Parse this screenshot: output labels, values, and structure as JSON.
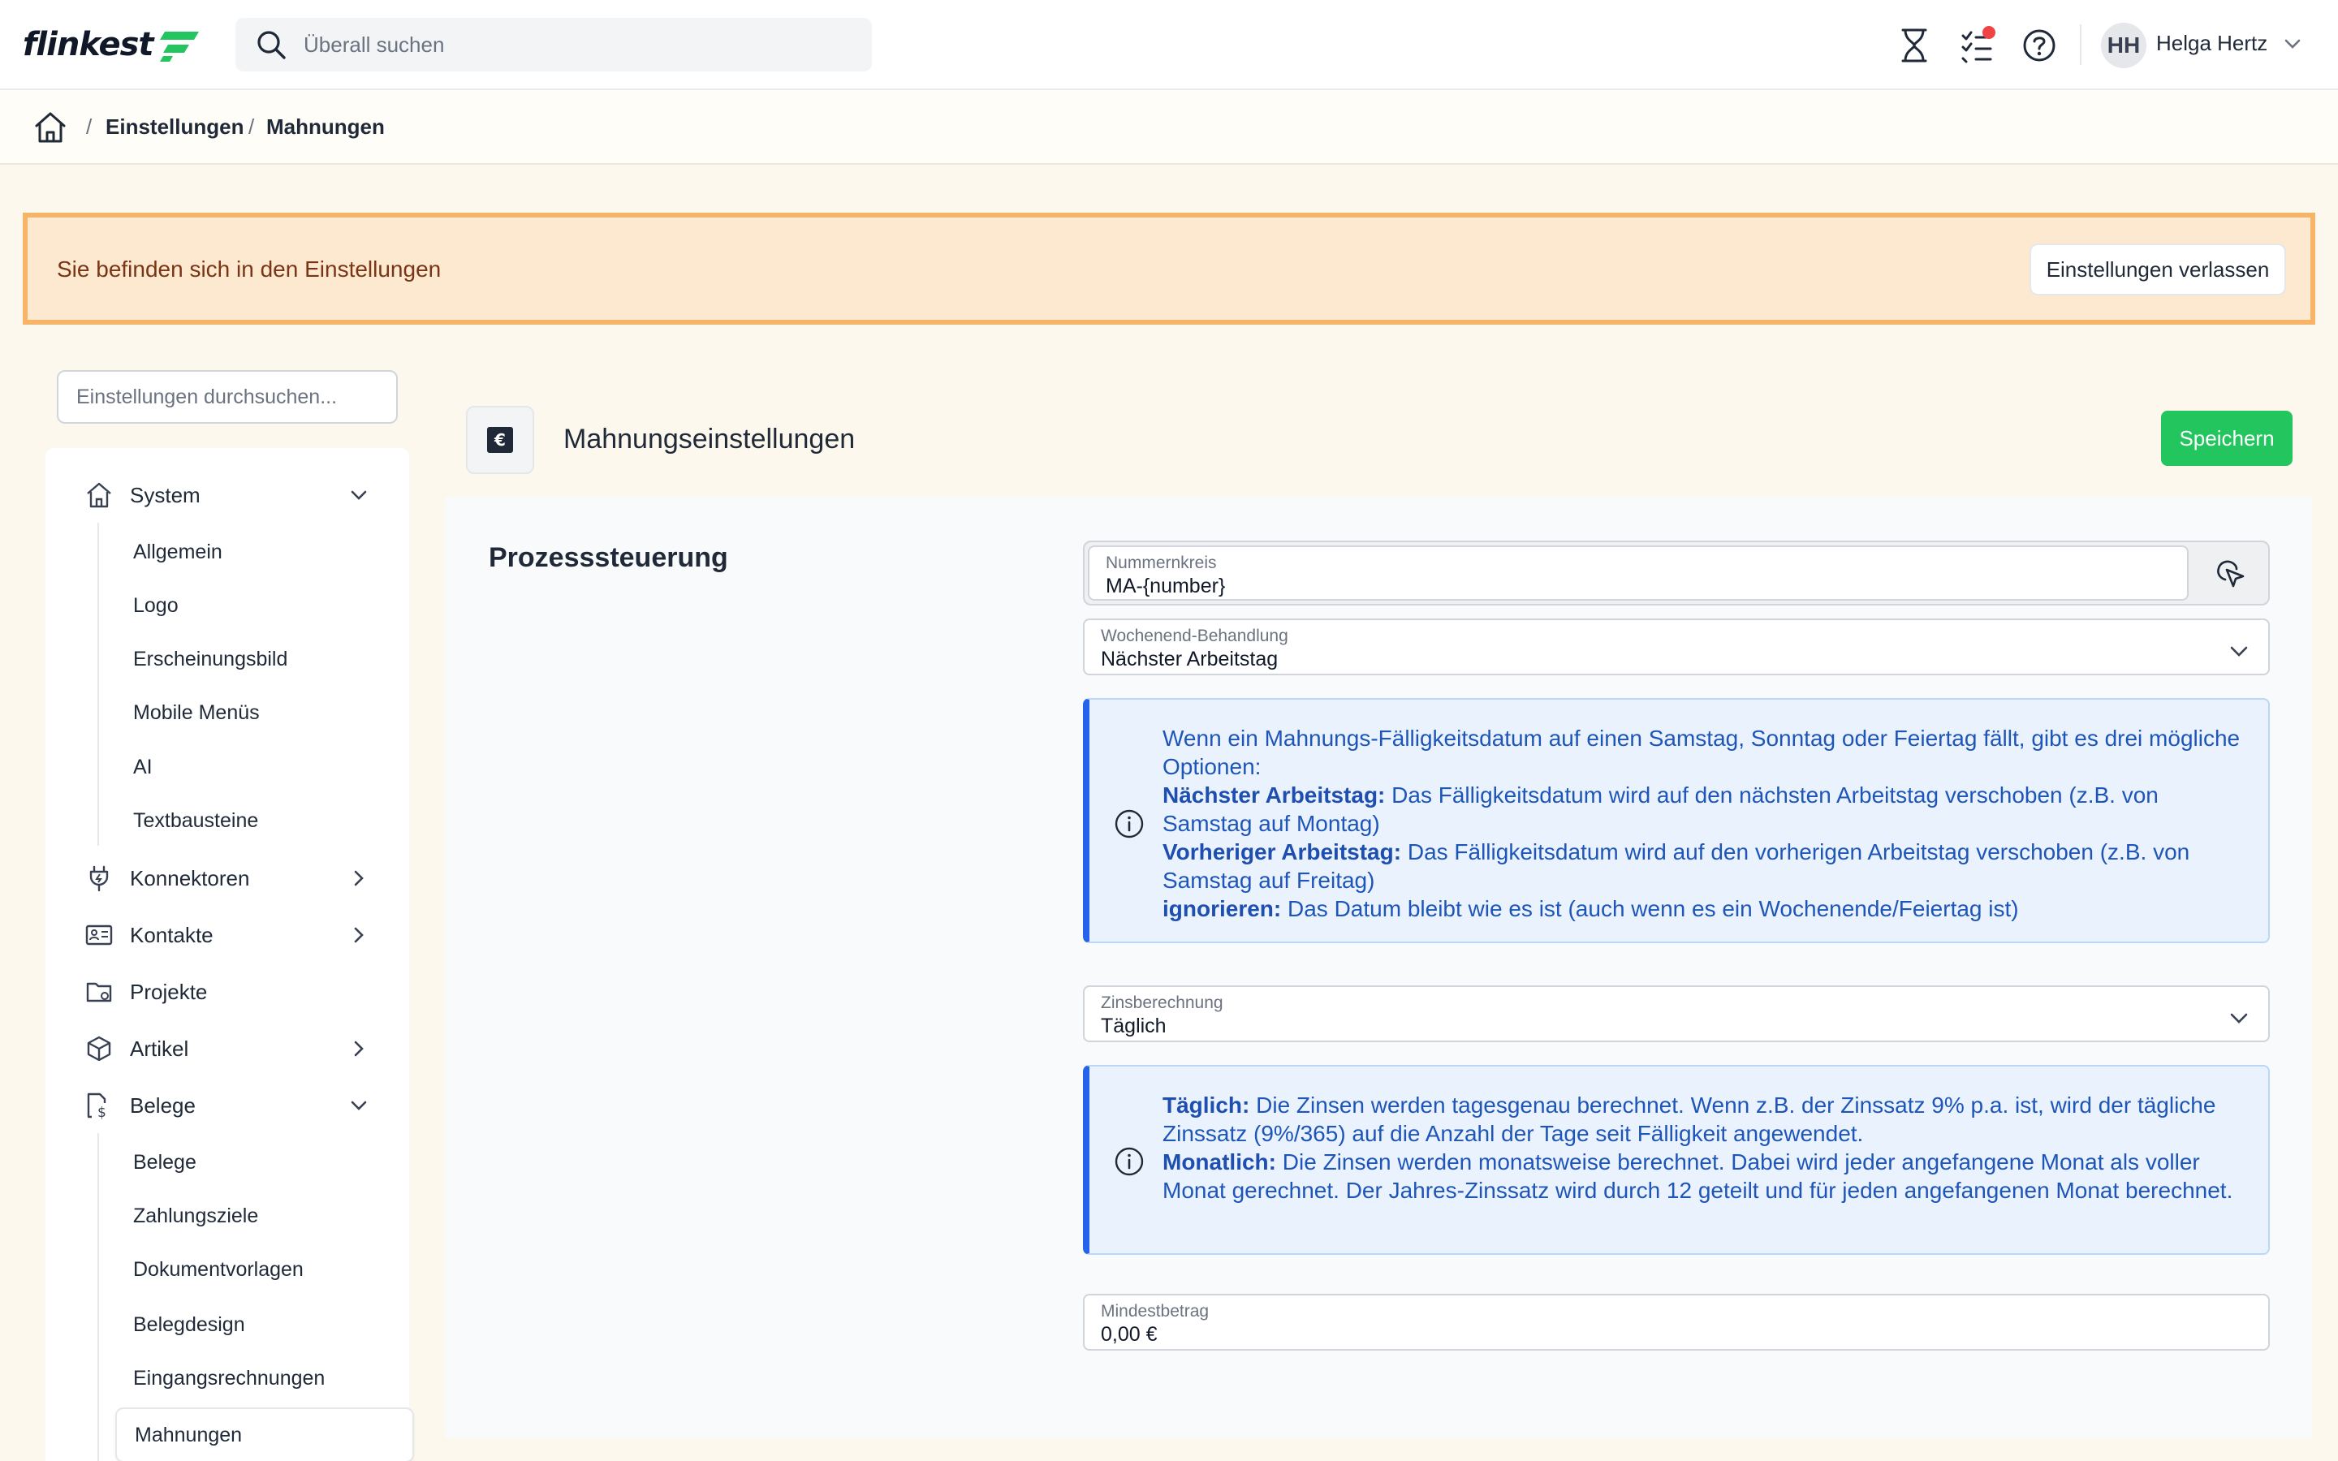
{
  "app": {
    "logo": "flinkest"
  },
  "header": {
    "search_placeholder": "Überall suchen",
    "user_initials": "HH",
    "user_name": "Helga Hertz"
  },
  "breadcrumb": {
    "items": [
      "Einstellungen",
      "Mahnungen"
    ],
    "separator": "/"
  },
  "banner": {
    "text": "Sie befinden sich in den Einstellungen",
    "exit_label": "Einstellungen verlassen"
  },
  "sidebar": {
    "search_placeholder": "Einstellungen durchsuchen...",
    "groups": [
      {
        "label": "System",
        "icon": "home-icon"
      },
      {
        "label": "Konnektoren",
        "icon": "plug-icon"
      },
      {
        "label": "Kontakte",
        "icon": "contact-card-icon"
      },
      {
        "label": "Projekte",
        "icon": "folder-gear-icon"
      },
      {
        "label": "Artikel",
        "icon": "box-icon"
      },
      {
        "label": "Belege",
        "icon": "document-dollar-icon"
      }
    ],
    "system_items": [
      "Allgemein",
      "Logo",
      "Erscheinungsbild",
      "Mobile Menüs",
      "AI",
      "Textbausteine"
    ],
    "belege_items": [
      "Belege",
      "Zahlungsziele",
      "Dokumentvorlagen",
      "Belegdesign",
      "Eingangsrechnungen",
      "Mahnungen"
    ]
  },
  "page": {
    "icon_glyph": "€",
    "title": "Mahnungseinstellungen",
    "save_label": "Speichern"
  },
  "section": {
    "title": "Prozesssteuerung",
    "nummernkreis": {
      "label": "Nummernkreis",
      "value": "MA-{number}"
    },
    "wochenende": {
      "label": "Wochenend-Behandlung",
      "value": "Nächster Arbeitstag"
    },
    "wochenende_info": {
      "intro": "Wenn ein Mahnungs-Fälligkeitsdatum auf einen Samstag, Sonntag oder Feiertag fällt, gibt es drei mögliche Optionen:",
      "opt1_title": "Nächster Arbeitstag:",
      "opt1_text": " Das Fälligkeitsdatum wird auf den nächsten Arbeitstag verschoben (z.B. von Samstag auf Montag)",
      "opt2_title": "Vorheriger Arbeitstag:",
      "opt2_text": " Das Fälligkeitsdatum wird auf den vorherigen Arbeitstag verschoben (z.B. von Samstag auf Freitag)",
      "opt3_title": "ignorieren:",
      "opt3_text": " Das Datum bleibt wie es ist (auch wenn es ein Wochenende/Feiertag ist)"
    },
    "zins": {
      "label": "Zinsberechnung",
      "value": "Täglich"
    },
    "zins_info": {
      "opt1_title": "Täglich:",
      "opt1_text": " Die Zinsen werden tagesgenau berechnet. Wenn z.B. der Zinssatz 9% p.a. ist, wird der tägliche Zinssatz (9%/365) auf die Anzahl der Tage seit Fälligkeit angewendet.",
      "opt2_title": "Monatlich:",
      "opt2_text": " Die Zinsen werden monatsweise berechnet. Dabei wird jeder angefangene Monat als voller Monat gerechnet. Der Jahres-Zinssatz wird durch 12 geteilt und für jeden angefangenen Monat berechnet."
    },
    "mindest": {
      "label": "Mindestbetrag",
      "value": "0,00 €"
    }
  },
  "colors": {
    "brand_green": "#22c55e",
    "banner_bg": "#fde8d0",
    "banner_border": "#f6b469",
    "info_blue": "#2563eb"
  }
}
